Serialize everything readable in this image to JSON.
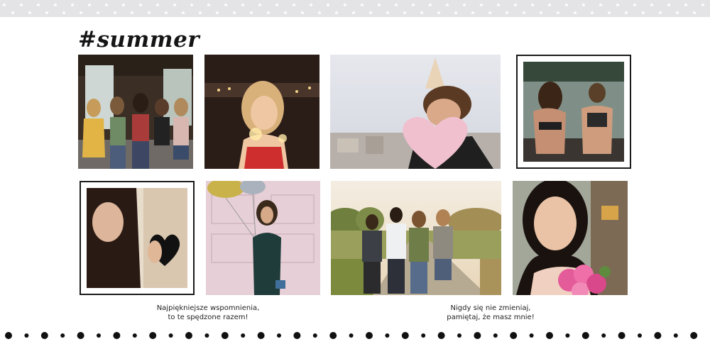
{
  "header": {
    "title": "#summer"
  },
  "photos": [
    {
      "id": "friends-hugging-porch",
      "frame": false
    },
    {
      "id": "woman-sparklers-night",
      "frame": false
    },
    {
      "id": "woman-party-hat-heart-balloon",
      "frame": false
    },
    {
      "id": "women-swimsuits-lake",
      "frame": true
    },
    {
      "id": "woman-holding-black-heart",
      "frame": true
    },
    {
      "id": "woman-balloons-pink-door",
      "frame": false
    },
    {
      "id": "friends-walking-road",
      "frame": false
    },
    {
      "id": "woman-selfie-pink-flowers",
      "frame": false
    }
  ],
  "captions": {
    "left": {
      "line1": "Najpiękniejsze wspomnienia,",
      "line2": "to te spędzone razem!"
    },
    "right": {
      "line1": "Nigdy się nie zmieniaj,",
      "line2": "pamiętaj, że masz mnie!"
    }
  },
  "colors": {
    "star_band": "#e4e4e6",
    "frame": "#1a1a1a",
    "dots": "#111111",
    "text": "#222222"
  }
}
